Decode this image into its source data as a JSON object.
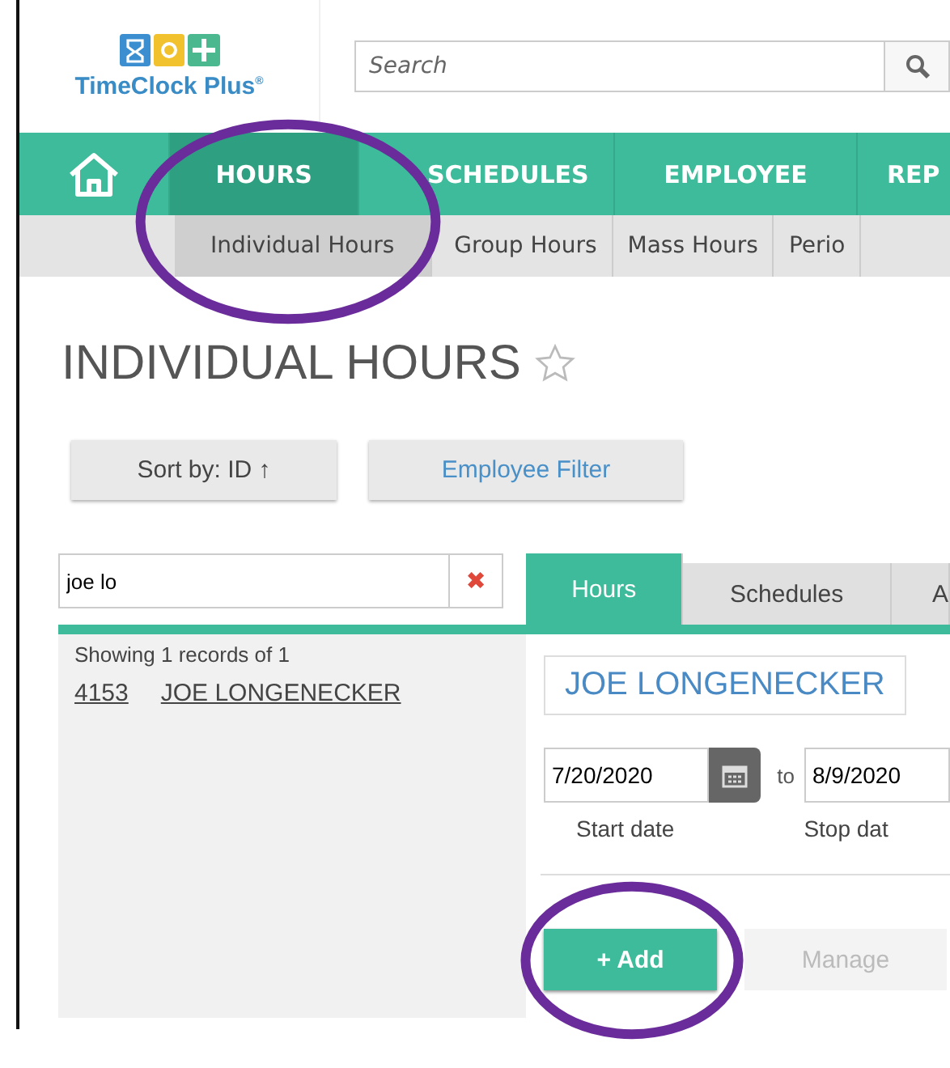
{
  "header": {
    "logo_text": "TimeClock Plus$^{®}$",
    "search": {
      "placeholder": "Search"
    }
  },
  "nav": [
    {
      "kind": "home",
      "selected": false
    },
    {
      "kind": "text",
      "label": "HOURS",
      "selected": true
    },
    {
      "kind": "text",
      "label": "SCHEDULES",
      "selected": false
    },
    {
      "kind": "text",
      "label": "EMPLOYEE",
      "selected": false
    },
    {
      "kind": "text",
      "label": "REP",
      "selected": false
    }
  ],
  "subnav": [
    {
      "label": "Individual Hours",
      "selected": true,
      "circled": true
    },
    {
      "label": "Group Hours",
      "selected": false,
      "circled": false
    },
    {
      "label": "Mass Hours",
      "selected": false,
      "circled": false
    },
    {
      "label": "Perio",
      "selected": false,
      "circled": false
    }
  ],
  "page_title": "INDIVIDUAL HOURS",
  "favorite": false,
  "toolbar": [
    {
      "kind": "dropdown",
      "label": "Sort by: ID ↑"
    },
    {
      "kind": "link",
      "label": "Employee Filter"
    }
  ],
  "employee_search": {
    "value": "joe lo",
    "clear": "✖"
  },
  "results": {
    "summary": "Showing 1 records of 1",
    "rows": [
      {
        "id": "4153",
        "name": "JOE LONGENECKER"
      }
    ]
  },
  "tabs": [
    {
      "label": "Hours",
      "selected": true
    },
    {
      "label": "Schedules",
      "selected": false
    },
    {
      "label": "A",
      "selected": false
    }
  ],
  "employee_select": "JOE LONGENECKER",
  "start": {
    "value": "7/20/2020",
    "label": "Start date"
  },
  "range_word": "to",
  "stop": {
    "value": "8/9/2020",
    "label": "Stop dat"
  },
  "actions": [
    {
      "kind": "add",
      "icon": "+",
      "label": "Add",
      "disabled": false,
      "circled": true
    },
    {
      "kind": "plain",
      "label": "Manage",
      "disabled": true,
      "circled": false
    }
  ]
}
